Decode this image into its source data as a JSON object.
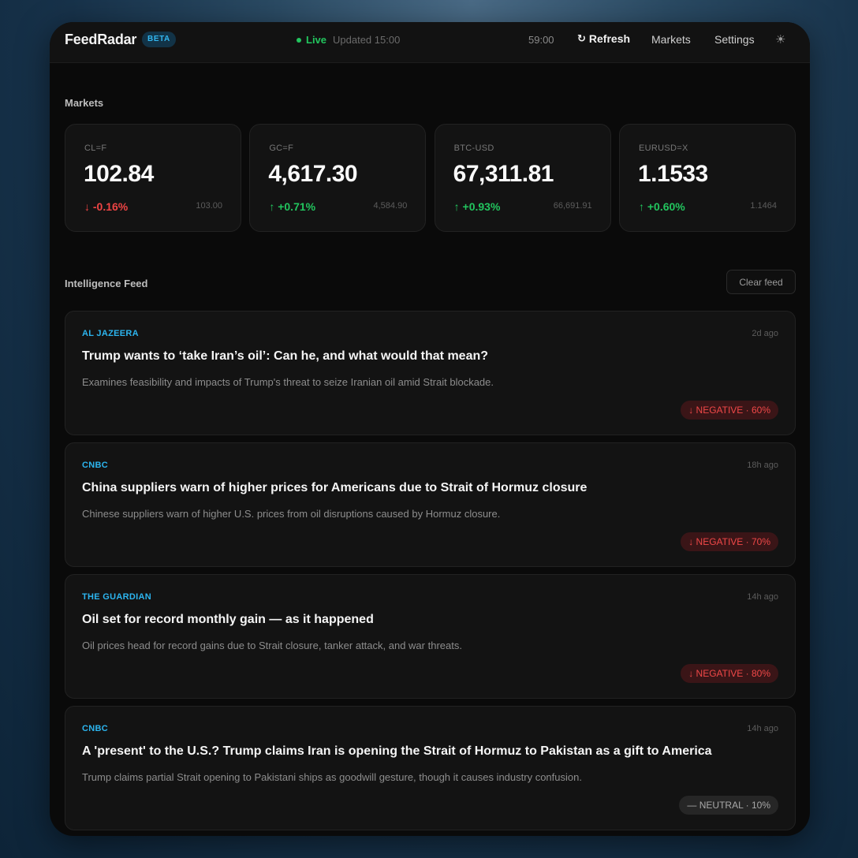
{
  "header": {
    "brand": "FeedRadar",
    "badge": "BETA",
    "live_label": "Live",
    "updated": "Updated 15:00",
    "timer": "59:00",
    "refresh_icon": "↻",
    "refresh_label": "Refresh",
    "nav_markets": "Markets",
    "nav_settings": "Settings",
    "theme_icon": "☀"
  },
  "colors": {
    "accent": "#2cb5ef",
    "positive": "#22c55e",
    "negative": "#ef4444",
    "neutral": "#a8a8a8"
  },
  "markets": {
    "title": "Markets",
    "cards": [
      {
        "symbol": "CL=F",
        "price": "102.84",
        "change": "↓ -0.16%",
        "direction": "neg",
        "prev": "103.00"
      },
      {
        "symbol": "GC=F",
        "price": "4,617.30",
        "change": "↑ +0.71%",
        "direction": "pos",
        "prev": "4,584.90"
      },
      {
        "symbol": "BTC-USD",
        "price": "67,311.81",
        "change": "↑ +0.93%",
        "direction": "pos",
        "prev": "66,691.91"
      },
      {
        "symbol": "EURUSD=X",
        "price": "1.1533",
        "change": "↑ +0.60%",
        "direction": "pos",
        "prev": "1.1464"
      }
    ]
  },
  "feed": {
    "title": "Intelligence Feed",
    "clear_label": "Clear feed",
    "items": [
      {
        "source": "AL JAZEERA",
        "time": "2d ago",
        "headline": "Trump wants to ‘take Iran’s oil’: Can he, and what would that mean?",
        "summary": "Examines feasibility and impacts of Trump's threat to seize Iranian oil amid Strait blockade.",
        "sentiment": "↓ NEGATIVE · 60%",
        "sentiment_type": "negative"
      },
      {
        "source": "CNBC",
        "time": "18h ago",
        "headline": "China suppliers warn of higher prices for Americans due to Strait of Hormuz closure",
        "summary": "Chinese suppliers warn of higher U.S. prices from oil disruptions caused by Hormuz closure.",
        "sentiment": "↓ NEGATIVE · 70%",
        "sentiment_type": "negative"
      },
      {
        "source": "THE GUARDIAN",
        "time": "14h ago",
        "headline": "Oil set for record monthly gain — as it happened",
        "summary": "Oil prices head for record gains due to Strait closure, tanker attack, and war threats.",
        "sentiment": "↓ NEGATIVE · 80%",
        "sentiment_type": "negative"
      },
      {
        "source": "CNBC",
        "time": "14h ago",
        "headline": "A 'present' to the U.S.? Trump claims Iran is opening the Strait of Hormuz to Pakistan as a gift to America",
        "summary": "Trump claims partial Strait opening to Pakistani ships as goodwill gesture, though it causes industry confusion.",
        "sentiment": "— NEUTRAL · 10%",
        "sentiment_type": "neutral"
      }
    ]
  }
}
